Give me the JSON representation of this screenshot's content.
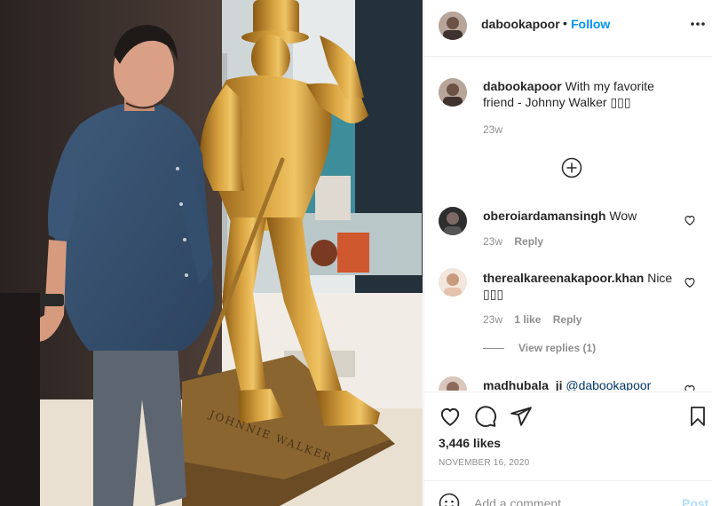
{
  "post": {
    "author": "dabookapoor",
    "follow_label": "Follow",
    "dot": "•",
    "more_icon": "more-options-icon"
  },
  "caption": {
    "username": "dabookapoor",
    "text": "With my favorite friend - Johnny Walker ",
    "emoji_marks": "▯▯▯",
    "time": "23w"
  },
  "comments": [
    {
      "username": "oberoiardamansingh",
      "text": "Wow",
      "time": "23w",
      "reply_label": "Reply"
    },
    {
      "username": "therealkareenakapoor.khan",
      "text": "Nice ",
      "emoji_marks": "▯▯▯",
      "time": "23w",
      "likes": "1 like",
      "reply_label": "Reply",
      "view_replies": "View replies (1)"
    },
    {
      "username": "madhubala_ji",
      "text": "@dabookapoor"
    }
  ],
  "likes": "3,446 likes",
  "date": "NOVEMBER 16, 2020",
  "add_comment": {
    "placeholder": "Add a comment...",
    "post_label": "Post"
  },
  "colors": {
    "accent": "#0095f6",
    "post_disabled": "#b2dffc",
    "muted": "#8e8e8e",
    "text": "#262626",
    "statue_gold": "#c9912f"
  }
}
